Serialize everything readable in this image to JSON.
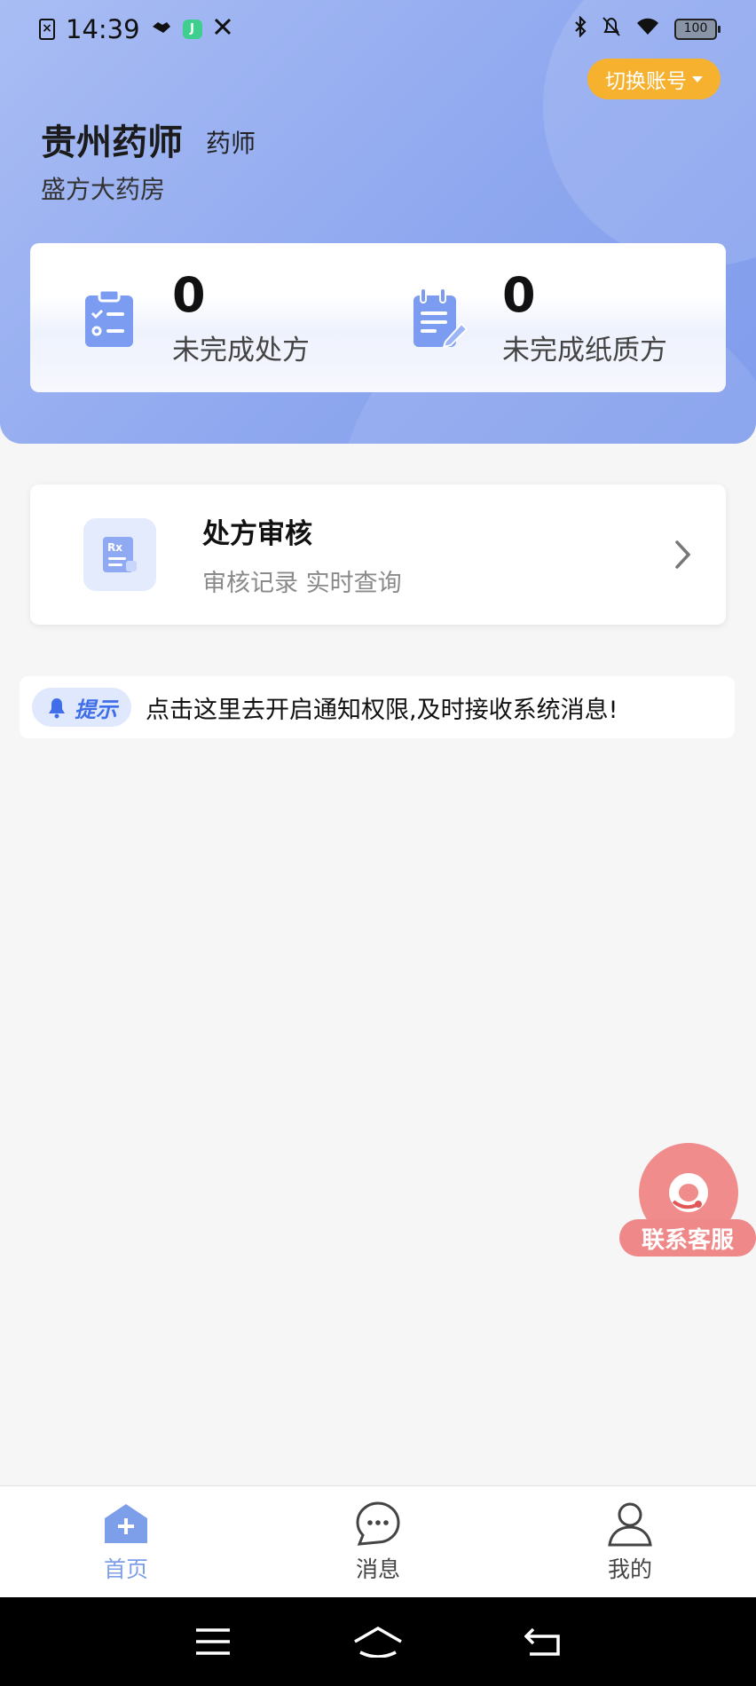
{
  "status_bar": {
    "time": "14:39",
    "battery": "100",
    "left_icons": [
      "sim-icon",
      "handshake-icon",
      "app-icon",
      "tools-icon"
    ],
    "right_icons": [
      "bluetooth-icon",
      "bell-off-icon",
      "wifi-icon",
      "battery-icon"
    ]
  },
  "header": {
    "switch_account": "切换账号",
    "user_name": "贵州药师",
    "user_role": "药师",
    "pharmacy": "盛方大药房",
    "colors": {
      "accent": "#8fa8ef",
      "switch": "#f6b12f"
    }
  },
  "stats": [
    {
      "value": "0",
      "label": "未完成处方",
      "icon": "clipboard-checklist-icon"
    },
    {
      "value": "0",
      "label": "未完成纸质方",
      "icon": "notepad-edit-icon"
    }
  ],
  "audit": {
    "title": "处方审核",
    "subtitle": "审核记录 实时查询",
    "icon": "rx-document-icon"
  },
  "notice": {
    "badge": "提示",
    "text": "点击这里去开启通知权限,及时接收系统消息!"
  },
  "customer_service": {
    "label": "联系客服"
  },
  "tabs": [
    {
      "label": "首页",
      "icon": "home-plus-icon",
      "active": true
    },
    {
      "label": "消息",
      "icon": "chat-bubble-icon",
      "active": false
    },
    {
      "label": "我的",
      "icon": "user-icon",
      "active": false
    }
  ],
  "nav": [
    "menu-icon",
    "home-icon",
    "back-icon"
  ]
}
